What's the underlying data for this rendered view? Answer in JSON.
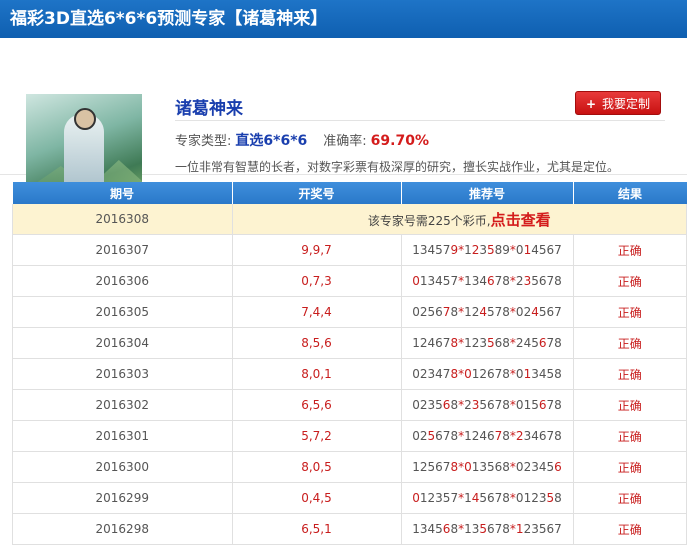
{
  "header": {
    "title": "福彩3D直选6*6*6预测专家【诸葛神来】"
  },
  "profile": {
    "name": "诸葛神来",
    "custom_button": "我要定制",
    "type_label": "专家类型:",
    "type_value": "直选6*6*6",
    "accuracy_label": "准确率:",
    "accuracy_value": "69.70%",
    "description": "一位非常有智慧的长者，对数字彩票有极深厚的研究，擅长实战作业，尤其是定位。"
  },
  "table": {
    "columns": [
      "期号",
      "开奖号",
      "推荐号",
      "结果"
    ],
    "locked_row": {
      "issue": "2016308",
      "text": "该专家号需225个彩币,",
      "link": "点击查看"
    },
    "rows": [
      {
        "issue": "2016307",
        "draw": "9,9,7",
        "rec": "134579*123589*014567",
        "hl": [
          [
            5
          ],
          [
            1,
            3
          ],
          [
            1
          ]
        ],
        "result": "正确"
      },
      {
        "issue": "2016306",
        "draw": "0,7,3",
        "rec": "013457*134678*235678",
        "hl": [
          [
            0
          ],
          [
            3
          ],
          [
            1
          ]
        ],
        "result": "正确"
      },
      {
        "issue": "2016305",
        "draw": "7,4,4",
        "rec": "025678*124578*024567",
        "hl": [
          [
            4
          ],
          [
            2
          ],
          [
            2
          ]
        ],
        "result": "正确"
      },
      {
        "issue": "2016304",
        "draw": "8,5,6",
        "rec": "124678*123568*245678",
        "hl": [
          [
            5
          ],
          [
            3
          ],
          [
            3
          ]
        ],
        "result": "正确"
      },
      {
        "issue": "2016303",
        "draw": "8,0,1",
        "rec": "023478*012678*013458",
        "hl": [
          [
            5
          ],
          [
            0
          ],
          [
            1
          ]
        ],
        "result": "正确"
      },
      {
        "issue": "2016302",
        "draw": "6,5,6",
        "rec": "023568*235678*015678",
        "hl": [
          [
            4
          ],
          [
            1
          ],
          [
            3
          ]
        ],
        "result": "正确"
      },
      {
        "issue": "2016301",
        "draw": "5,7,2",
        "rec": "025678*124678*234678",
        "hl": [
          [
            2
          ],
          [
            4
          ],
          [
            0
          ]
        ],
        "result": "正确"
      },
      {
        "issue": "2016300",
        "draw": "8,0,5",
        "rec": "125678*013568*023456",
        "hl": [
          [
            5
          ],
          [
            0
          ],
          [
            5
          ]
        ],
        "result": "正确"
      },
      {
        "issue": "2016299",
        "draw": "0,4,5",
        "rec": "012357*145678*012358",
        "hl": [
          [
            0
          ],
          [
            1
          ],
          [
            4
          ]
        ],
        "result": "正确"
      },
      {
        "issue": "2016298",
        "draw": "6,5,1",
        "rec": "134568*135678*123567",
        "hl": [
          [
            4
          ],
          [
            2
          ],
          [
            0
          ]
        ],
        "result": "正确"
      }
    ]
  }
}
